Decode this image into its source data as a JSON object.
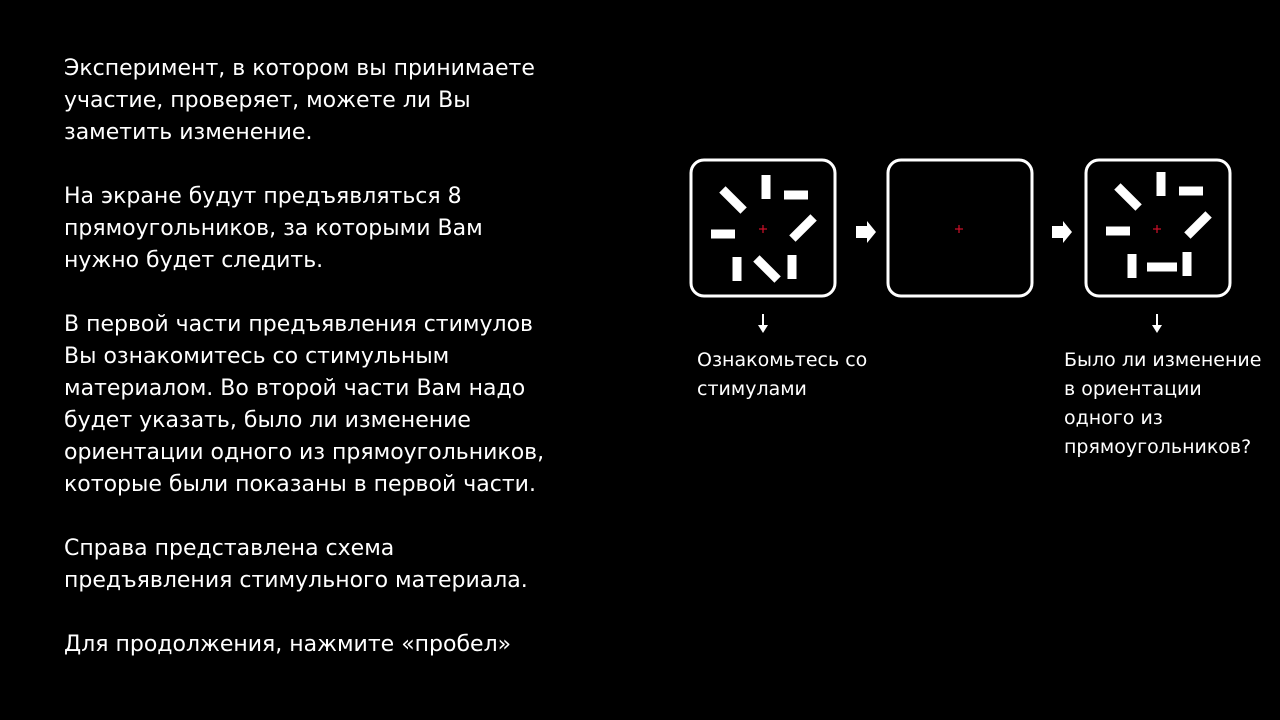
{
  "instructions": {
    "p1": "Эксперимент, в котором вы принимаете участие, проверяет, можете ли Вы заметить изменение.",
    "p2": "На экране будут предъявляться 8 прямоугольников, за которыми Вам нужно будет следить.",
    "p3": "В первой части предъявления стимулов Вы ознакомитесь со стимульным материалом. Во второй части Вам надо будет указать, было ли изменение ориентации одного из прямоугольников, которые были показаны в первой части.",
    "p4": "Справа представлена схема предъявления стимульного материала.",
    "p5": "Для продолжения, нажмите «пробел»"
  },
  "schema": {
    "caption_first": "Ознакомьтесь со стимулами",
    "caption_last": "Было ли изменение в ориентации одного из прямоугольников?"
  },
  "colors": {
    "background": "#000000",
    "foreground": "#ffffff",
    "fixation": "#d0102a"
  }
}
